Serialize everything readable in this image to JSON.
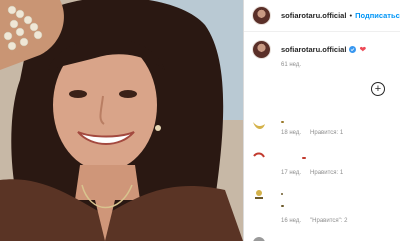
{
  "post": {
    "username": "sofiarotaru.official",
    "follow_label": "Подписаться",
    "header_separator": "•"
  },
  "caption": {
    "username": "sofiarotaru.official",
    "emoji": "❤",
    "time": "61 нед."
  },
  "add_comment_icon": "plus-circle-icon",
  "comments": [
    {
      "time": "18 нед.",
      "likes": "Нравится: 1",
      "reply": ""
    },
    {
      "time": "17 нед.",
      "likes": "Нравится: 1",
      "reply": ""
    },
    {
      "time": "16 нед.",
      "likes": "\"Нравится\": 2",
      "reply": ""
    }
  ],
  "colors": {
    "accent": "#0095f6",
    "verified": "#3897f0",
    "heart": "#ed4956",
    "muted_text": "#8e8e8e",
    "text": "#262626"
  }
}
